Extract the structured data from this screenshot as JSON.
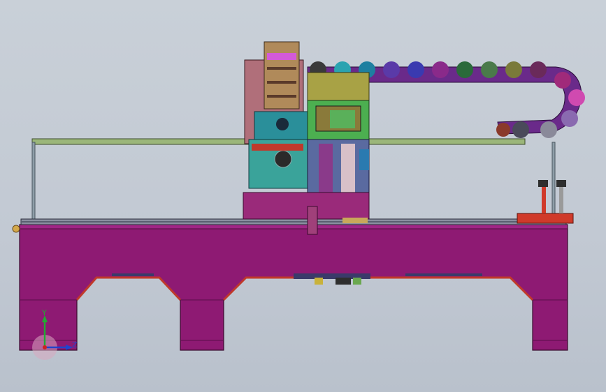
{
  "app": {
    "title": ""
  },
  "triad": {
    "y_label": "Y",
    "z_label": "Z"
  },
  "colors": {
    "background": "#c4cbd4",
    "frame": "#8e1a73",
    "frame_edge": "#5a0f48",
    "rail": "#9bb67a",
    "chain": "#6a2a8a",
    "head_teal": "#2aa39a",
    "head_olive": "#a8a245",
    "head_green": "#4caf50",
    "red_part": "#d03a2a",
    "post": "#6f7f88"
  }
}
